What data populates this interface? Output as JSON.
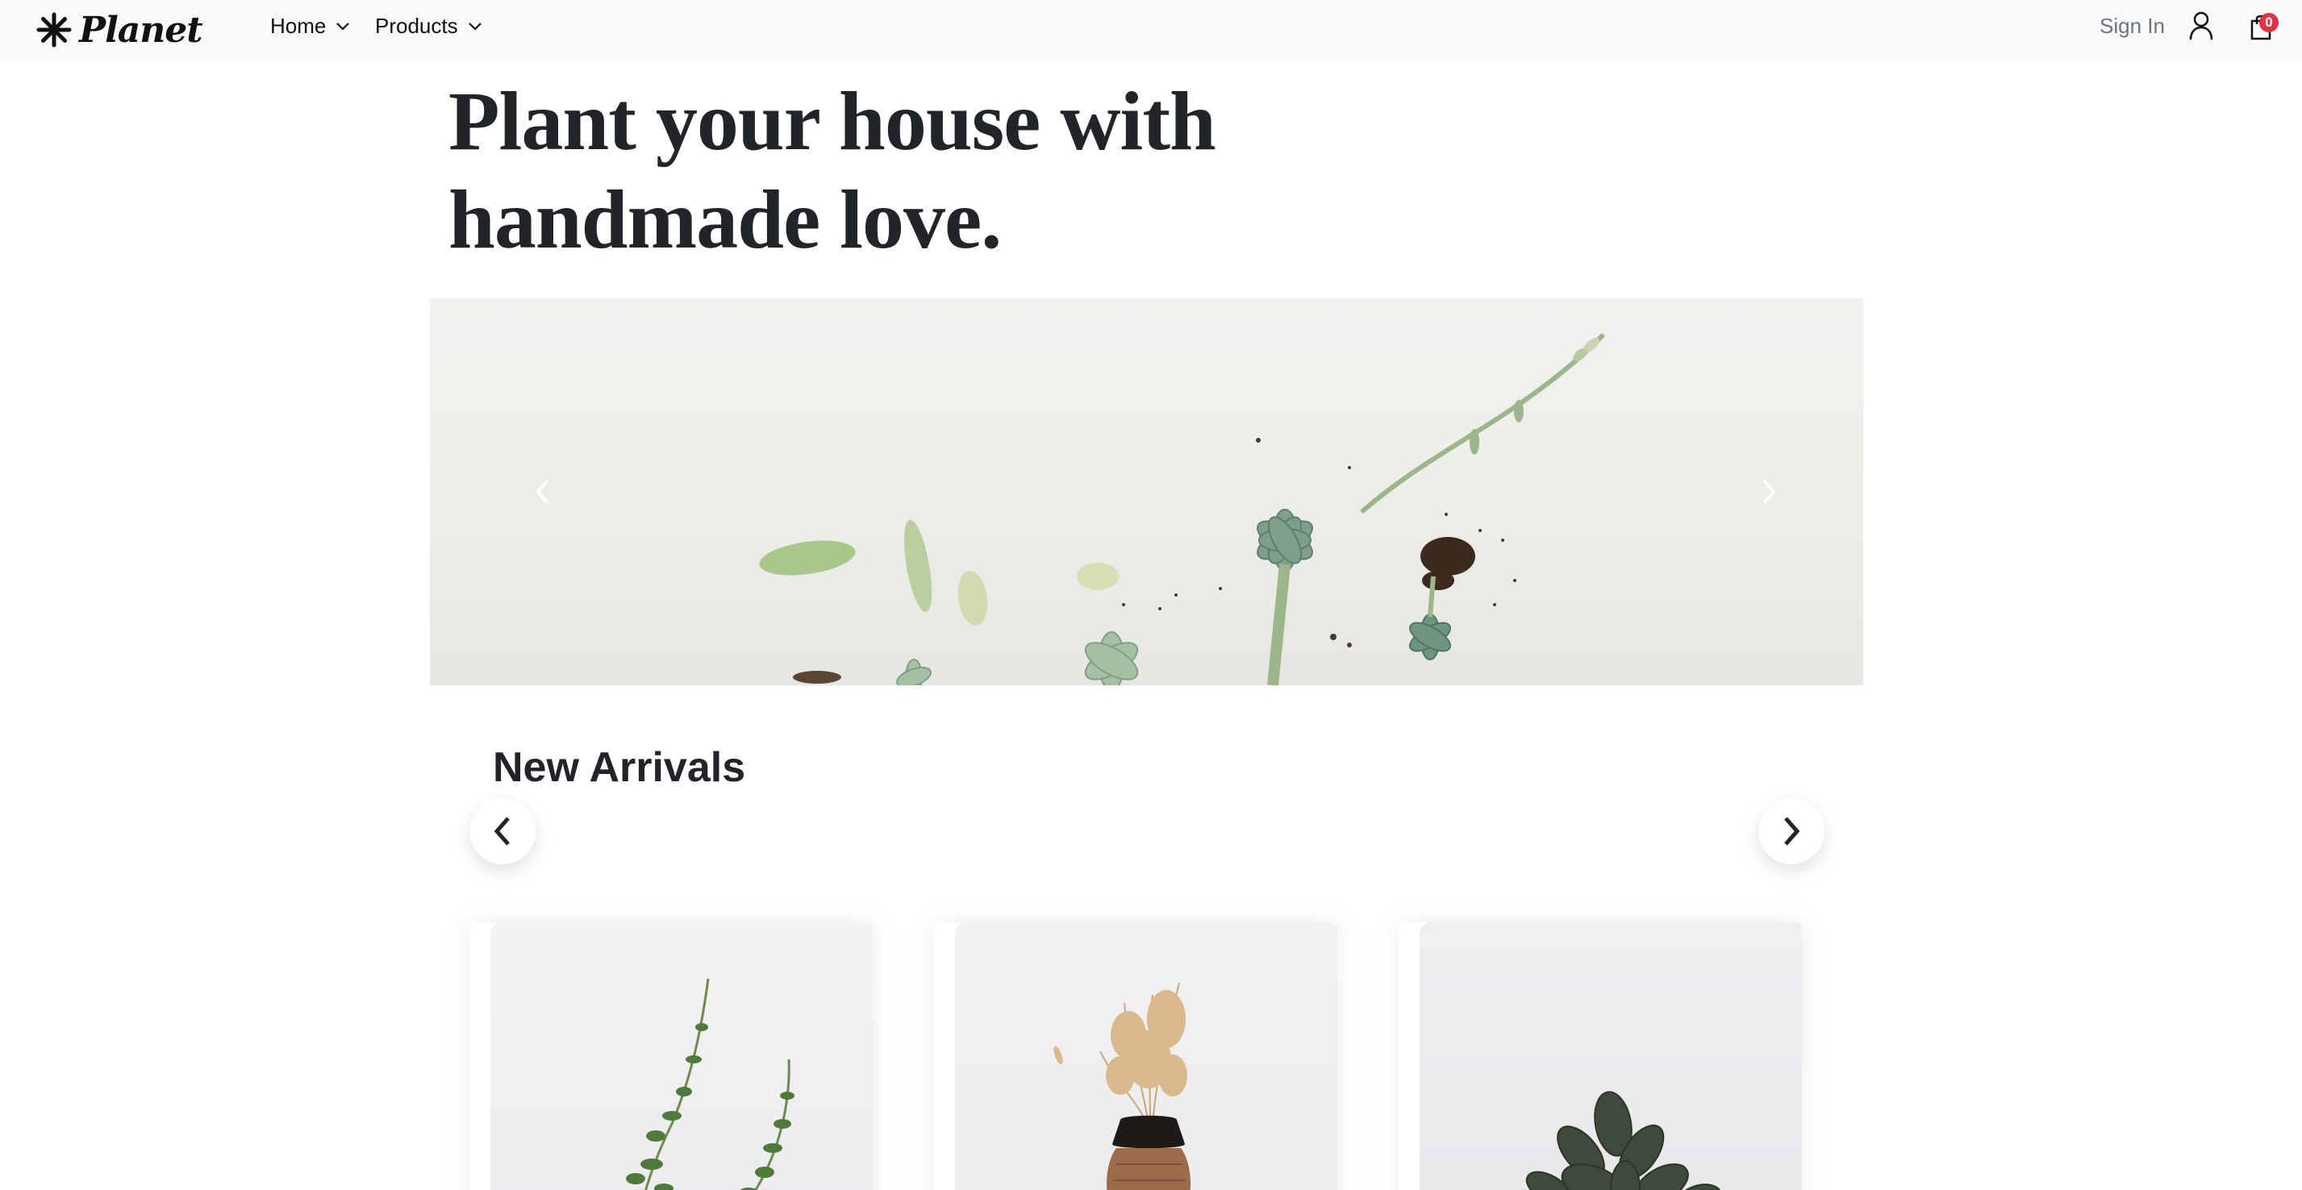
{
  "navbar": {
    "brand": "Planet",
    "menu": [
      {
        "label": "Home"
      },
      {
        "label": "Products"
      }
    ],
    "signin_label": "Sign In",
    "cart_count": "0"
  },
  "hero": {
    "title_line1": "Plant your house with",
    "title_line2": "handmade love."
  },
  "new_arrivals": {
    "title": "New Arrivals"
  },
  "colors": {
    "accent_badge": "#dc3545",
    "navbar_bg": "#f8f9fa",
    "text": "#212529"
  },
  "icons": [
    "asterisk-logo-icon",
    "chevron-down-icon",
    "user-icon",
    "shopping-bag-icon",
    "chevron-left-icon",
    "chevron-right-icon"
  ]
}
